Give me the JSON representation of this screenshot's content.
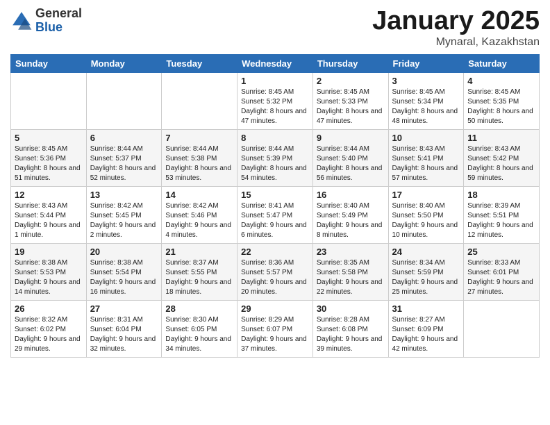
{
  "logo": {
    "general": "General",
    "blue": "Blue"
  },
  "header": {
    "title": "January 2025",
    "location": "Mynaral, Kazakhstan"
  },
  "days_of_week": [
    "Sunday",
    "Monday",
    "Tuesday",
    "Wednesday",
    "Thursday",
    "Friday",
    "Saturday"
  ],
  "weeks": [
    [
      {
        "day": "",
        "content": ""
      },
      {
        "day": "",
        "content": ""
      },
      {
        "day": "",
        "content": ""
      },
      {
        "day": "1",
        "content": "Sunrise: 8:45 AM\nSunset: 5:32 PM\nDaylight: 8 hours and 47 minutes."
      },
      {
        "day": "2",
        "content": "Sunrise: 8:45 AM\nSunset: 5:33 PM\nDaylight: 8 hours and 47 minutes."
      },
      {
        "day": "3",
        "content": "Sunrise: 8:45 AM\nSunset: 5:34 PM\nDaylight: 8 hours and 48 minutes."
      },
      {
        "day": "4",
        "content": "Sunrise: 8:45 AM\nSunset: 5:35 PM\nDaylight: 8 hours and 50 minutes."
      }
    ],
    [
      {
        "day": "5",
        "content": "Sunrise: 8:45 AM\nSunset: 5:36 PM\nDaylight: 8 hours and 51 minutes."
      },
      {
        "day": "6",
        "content": "Sunrise: 8:44 AM\nSunset: 5:37 PM\nDaylight: 8 hours and 52 minutes."
      },
      {
        "day": "7",
        "content": "Sunrise: 8:44 AM\nSunset: 5:38 PM\nDaylight: 8 hours and 53 minutes."
      },
      {
        "day": "8",
        "content": "Sunrise: 8:44 AM\nSunset: 5:39 PM\nDaylight: 8 hours and 54 minutes."
      },
      {
        "day": "9",
        "content": "Sunrise: 8:44 AM\nSunset: 5:40 PM\nDaylight: 8 hours and 56 minutes."
      },
      {
        "day": "10",
        "content": "Sunrise: 8:43 AM\nSunset: 5:41 PM\nDaylight: 8 hours and 57 minutes."
      },
      {
        "day": "11",
        "content": "Sunrise: 8:43 AM\nSunset: 5:42 PM\nDaylight: 8 hours and 59 minutes."
      }
    ],
    [
      {
        "day": "12",
        "content": "Sunrise: 8:43 AM\nSunset: 5:44 PM\nDaylight: 9 hours and 1 minute."
      },
      {
        "day": "13",
        "content": "Sunrise: 8:42 AM\nSunset: 5:45 PM\nDaylight: 9 hours and 2 minutes."
      },
      {
        "day": "14",
        "content": "Sunrise: 8:42 AM\nSunset: 5:46 PM\nDaylight: 9 hours and 4 minutes."
      },
      {
        "day": "15",
        "content": "Sunrise: 8:41 AM\nSunset: 5:47 PM\nDaylight: 9 hours and 6 minutes."
      },
      {
        "day": "16",
        "content": "Sunrise: 8:40 AM\nSunset: 5:49 PM\nDaylight: 9 hours and 8 minutes."
      },
      {
        "day": "17",
        "content": "Sunrise: 8:40 AM\nSunset: 5:50 PM\nDaylight: 9 hours and 10 minutes."
      },
      {
        "day": "18",
        "content": "Sunrise: 8:39 AM\nSunset: 5:51 PM\nDaylight: 9 hours and 12 minutes."
      }
    ],
    [
      {
        "day": "19",
        "content": "Sunrise: 8:38 AM\nSunset: 5:53 PM\nDaylight: 9 hours and 14 minutes."
      },
      {
        "day": "20",
        "content": "Sunrise: 8:38 AM\nSunset: 5:54 PM\nDaylight: 9 hours and 16 minutes."
      },
      {
        "day": "21",
        "content": "Sunrise: 8:37 AM\nSunset: 5:55 PM\nDaylight: 9 hours and 18 minutes."
      },
      {
        "day": "22",
        "content": "Sunrise: 8:36 AM\nSunset: 5:57 PM\nDaylight: 9 hours and 20 minutes."
      },
      {
        "day": "23",
        "content": "Sunrise: 8:35 AM\nSunset: 5:58 PM\nDaylight: 9 hours and 22 minutes."
      },
      {
        "day": "24",
        "content": "Sunrise: 8:34 AM\nSunset: 5:59 PM\nDaylight: 9 hours and 25 minutes."
      },
      {
        "day": "25",
        "content": "Sunrise: 8:33 AM\nSunset: 6:01 PM\nDaylight: 9 hours and 27 minutes."
      }
    ],
    [
      {
        "day": "26",
        "content": "Sunrise: 8:32 AM\nSunset: 6:02 PM\nDaylight: 9 hours and 29 minutes."
      },
      {
        "day": "27",
        "content": "Sunrise: 8:31 AM\nSunset: 6:04 PM\nDaylight: 9 hours and 32 minutes."
      },
      {
        "day": "28",
        "content": "Sunrise: 8:30 AM\nSunset: 6:05 PM\nDaylight: 9 hours and 34 minutes."
      },
      {
        "day": "29",
        "content": "Sunrise: 8:29 AM\nSunset: 6:07 PM\nDaylight: 9 hours and 37 minutes."
      },
      {
        "day": "30",
        "content": "Sunrise: 8:28 AM\nSunset: 6:08 PM\nDaylight: 9 hours and 39 minutes."
      },
      {
        "day": "31",
        "content": "Sunrise: 8:27 AM\nSunset: 6:09 PM\nDaylight: 9 hours and 42 minutes."
      },
      {
        "day": "",
        "content": ""
      }
    ]
  ]
}
